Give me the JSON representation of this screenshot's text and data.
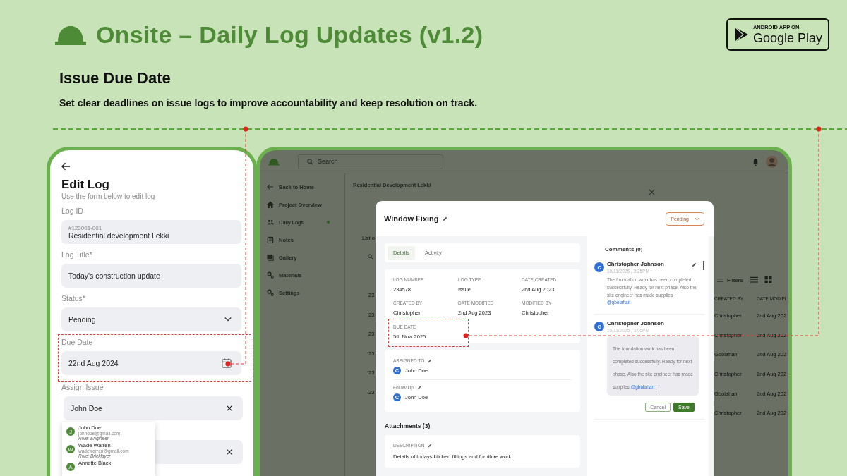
{
  "header": {
    "title": "Onsite – Daily Log Updates (v1.2)",
    "store_badge": {
      "small": "ANDROID APP ON",
      "large": "Google Play"
    }
  },
  "feature": {
    "heading": "Issue Due Date",
    "description": "Set clear deadlines on issue logs to improve accountability and keep resolution on track."
  },
  "phone": {
    "title": "Edit Log",
    "subtitle": "Use the form below to edit log",
    "fields": [
      {
        "kind": "text",
        "label": "Log ID",
        "hint": "#123001-001",
        "value": "Residential development Lekki",
        "highlighted": false
      },
      {
        "kind": "text",
        "label": "Log Title*",
        "value": "Today's construction update",
        "highlighted": false
      },
      {
        "kind": "select",
        "label": "Status*",
        "value": "Pending",
        "highlighted": false
      },
      {
        "kind": "date",
        "label": "Due Date",
        "value": "22nd Aug 2024",
        "highlighted": true
      },
      {
        "kind": "clearable",
        "label": "Assign Issue",
        "value": "John Doe",
        "highlighted": false
      },
      {
        "kind": "clearable",
        "highlighted": false
      }
    ],
    "suggestions": [
      {
        "initial": "J",
        "name": "John Doe",
        "email": "johndoe@gmail.com",
        "role": "Role: Engineer"
      },
      {
        "initial": "W",
        "name": "Wade Warren",
        "email": "wadewarren@gmail.com",
        "role": "Role: Bricklayer"
      },
      {
        "initial": "A",
        "name": "Annette Black"
      }
    ]
  },
  "tablet": {
    "search": {
      "placeholder": "Search"
    },
    "sidebar": {
      "back": "Back to Home",
      "items": [
        {
          "label": "Project Overview",
          "selected": false
        },
        {
          "label": "Daily Logs",
          "selected": true
        },
        {
          "label": "Notes",
          "selected": false
        },
        {
          "label": "Gallery",
          "selected": false
        },
        {
          "label": "Materials",
          "selected": false
        },
        {
          "label": "Settings",
          "selected": false
        }
      ]
    },
    "breadcrumb": "Residential Development Lekki",
    "list_heading": "List o",
    "row_ids": [
      "23",
      "23",
      "23",
      "23",
      "23",
      "23"
    ],
    "filters": "Filters",
    "columns": [
      "CREATED BY",
      "DATE MODIFI"
    ],
    "rows": [
      {
        "created_by": "Christopher",
        "date_modified": "2nd Aug 202"
      },
      {
        "created_by": "Christopher",
        "date_modified": "2nd Aug 202"
      },
      {
        "created_by": "Gbolahan",
        "date_modified": "2nd Aug 202"
      },
      {
        "created_by": "Christopher",
        "date_modified": "2nd Aug 202"
      },
      {
        "created_by": "Gbolahan",
        "date_modified": "2nd Aug 202"
      },
      {
        "created_by": "Christopher",
        "date_modified": "2nd Aug 202"
      }
    ]
  },
  "modal": {
    "title": "Window Fixing",
    "status": "Pending",
    "tabs": [
      {
        "label": "Details",
        "selected": true
      },
      {
        "label": "Activity",
        "selected": false
      }
    ],
    "details": [
      {
        "label": "LOG NUMBER",
        "value": "234578",
        "highlighted": false
      },
      {
        "label": "LOG TYPE",
        "value": "Issue",
        "highlighted": false
      },
      {
        "label": "DATE CREATED",
        "value": "2nd Aug 2023",
        "highlighted": false
      },
      {
        "label": "CREATED BY",
        "value": "Christopher",
        "highlighted": false
      },
      {
        "label": "DATE MODIFIED",
        "value": "2nd Aug 2023",
        "highlighted": false
      },
      {
        "label": "MODIFIED BY",
        "value": "Christopher",
        "highlighted": false
      },
      {
        "label": "DUE DATE",
        "value": "5th Now 2025",
        "highlighted": true
      }
    ],
    "assignment": [
      {
        "label": "ASSIGNED TO",
        "initial": "C",
        "person": "John Doe"
      },
      {
        "label": "Follow Up",
        "initial": "C",
        "person": "John Doe"
      }
    ],
    "attachments_heading": "Attachments (3)",
    "description": {
      "label": "DESCRIPTION",
      "text": "Details of todays kitchen fittings and furniture work"
    },
    "comments": {
      "heading": "Comments (0)",
      "items": [
        {
          "kind": "posted",
          "initial": "C",
          "name": "Christopher Johnson",
          "time": "10/11/2025 , 3:25PM",
          "text": "The foundation work has been completed successfully. Ready for next phase. Also the site engineer has made supplies",
          "mention": "@gbolahan"
        },
        {
          "kind": "editing",
          "initial": "C",
          "name": "Christopher Johnson",
          "time": "10/11/2025 , 3:05PM",
          "text": "The foundation work has been completed successfully. Ready for next phase. Also the site engineer has made supplies",
          "mention": "@gbolahan",
          "buttons": [
            "Cancel",
            "Save"
          ]
        }
      ]
    }
  }
}
